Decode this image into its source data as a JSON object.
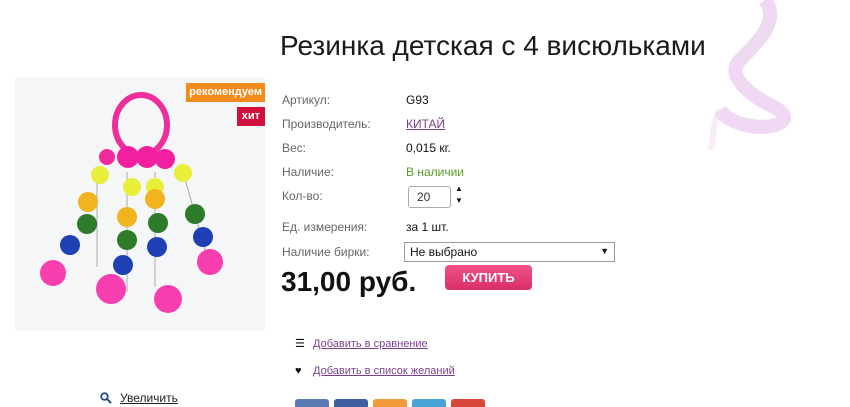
{
  "product": {
    "title": "Резинка детская с 4 висюльками",
    "badges": {
      "recommend": "рекомендуем",
      "hit": "хит"
    },
    "zoom_label": "Увеличить"
  },
  "attributes": {
    "article": {
      "label": "Артикул:",
      "value": "G93"
    },
    "manufacturer": {
      "label": "Производитель:",
      "value": "КИТАЙ"
    },
    "weight": {
      "label": "Вес:",
      "value": "0,015 кг."
    },
    "availability": {
      "label": "Наличие:",
      "value": "В наличии"
    },
    "quantity": {
      "label": "Кол-во:",
      "value": "20"
    },
    "unit": {
      "label": "Ед. измерения:",
      "value": "за 1 шт."
    },
    "tag": {
      "label": "Наличие бирки:",
      "value": "Не выбрано"
    }
  },
  "price": "31,00 руб.",
  "buy_label": "КУПИТЬ",
  "actions": {
    "compare": "Добавить в сравнение",
    "wishlist": "Добавить в список желаний"
  },
  "colors": {
    "accent": "#d82e69",
    "link": "#7b3f8f",
    "in_stock": "#5a9a2a",
    "badge_recommend": "#f28a1c",
    "badge_hit": "#d1113c"
  },
  "share_colors": [
    "#5b7bb4",
    "#3e5f9e",
    "#f09a3a",
    "#4aa3d6",
    "#d9473a"
  ]
}
